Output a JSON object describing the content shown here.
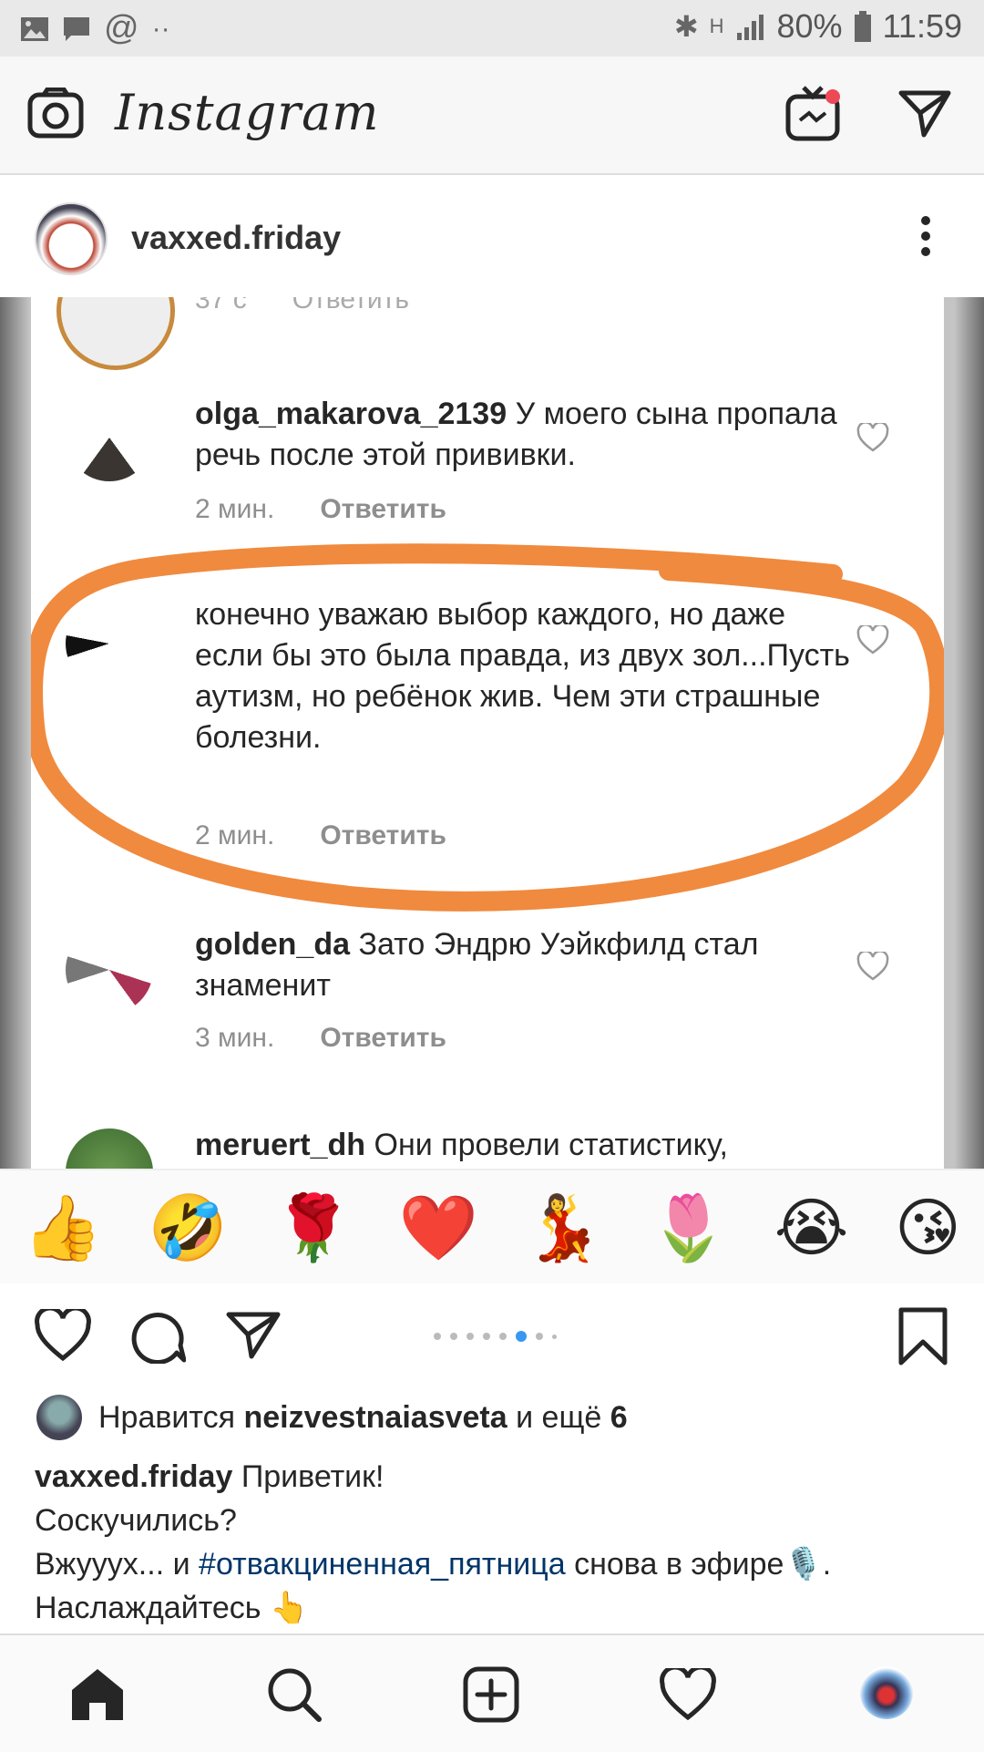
{
  "status_bar": {
    "battery": "80%",
    "time": "11:59"
  },
  "app": {
    "title": "Instagram"
  },
  "post": {
    "username": "vaxxed.friday",
    "embedded_comments": [
      {
        "id": "c0",
        "text_partial": "",
        "time": "",
        "reply": ""
      },
      {
        "id": "c1",
        "username": "olga_makarova_2139",
        "text": "У моего сына пропала речь после этой прививки.",
        "time": "2 мин.",
        "reply": "Ответить"
      },
      {
        "id": "c2",
        "username": "",
        "text": "конечно уважаю выбор каждого, но даже если бы это была правда, из двух зол...Пусть аутизм, но ребёнок жив. Чем эти страшные болезни.",
        "time": "2 мин.",
        "reply": "Ответить"
      },
      {
        "id": "c3",
        "username": "golden_da",
        "text": "Зато Эндрю Уэйкфилд стал знаменит",
        "time": "3 мин.",
        "reply": "Ответить"
      },
      {
        "id": "c4",
        "username": "meruert_dh",
        "text": "Они провели статистику,",
        "time": "",
        "reply": ""
      }
    ],
    "emoji_bar": [
      "👍",
      "🤣",
      "🌹",
      "❤️",
      "💃",
      "🌷",
      "😭",
      "😘"
    ],
    "carousel": {
      "count": 8,
      "active_index": 5
    },
    "likes": {
      "prefix": "Нравится",
      "user": "neizvestnaiasveta",
      "suffix": "и ещё",
      "count": "6"
    },
    "caption": {
      "username": "vaxxed.friday",
      "line1": "Приветик!",
      "line2": "Соскучились?",
      "line3_pre": "Вжууух... и",
      "hashtag": "#отвакциненная_пятница",
      "line3_post": "снова в эфире🎙️.",
      "line4": "Наслаждайтесь 👆"
    }
  },
  "colors": {
    "highlight": "#f08a3e",
    "link": "#003569",
    "active_dot": "#3897f0"
  },
  "icons": [
    "camera-icon",
    "igtv-icon",
    "direct-icon",
    "more-icon",
    "heart-icon",
    "comment-icon",
    "share-icon",
    "bookmark-icon",
    "home-icon",
    "search-icon",
    "add-icon",
    "activity-icon",
    "profile-icon"
  ]
}
